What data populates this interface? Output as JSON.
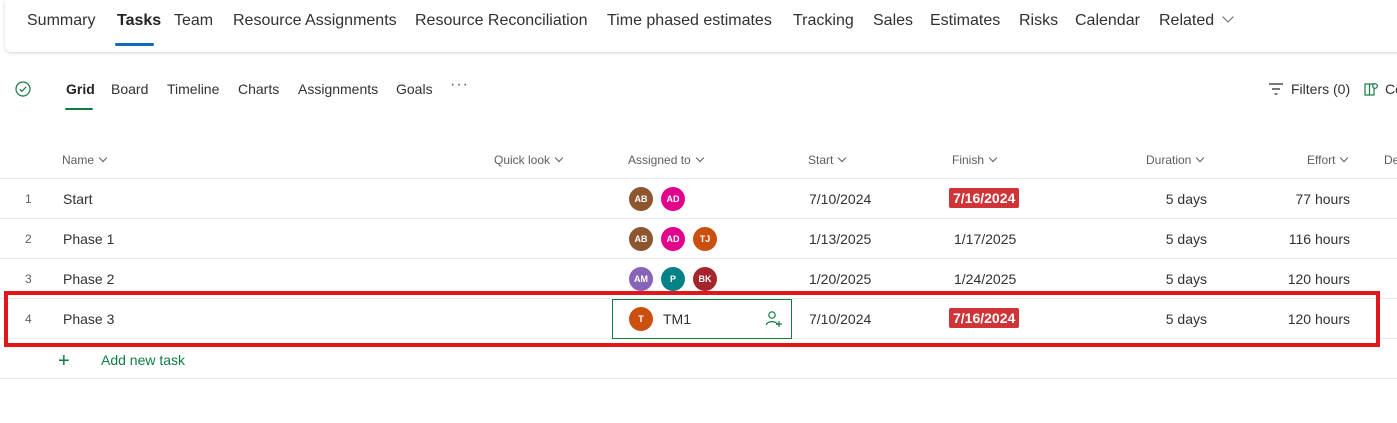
{
  "top_tabs": [
    "Summary",
    "Tasks",
    "Team",
    "Resource Assignments",
    "Resource Reconciliation",
    "Time phased estimates",
    "Tracking",
    "Sales",
    "Estimates",
    "Risks",
    "Calendar",
    "Related"
  ],
  "sub_tabs": [
    "Grid",
    "Board",
    "Timeline",
    "Charts",
    "Assignments",
    "Goals"
  ],
  "more_label": "···",
  "filters_label": "Filters (0)",
  "column_btn_label": "Co",
  "columns": {
    "name": "Name",
    "quick_look": "Quick look",
    "assigned_to": "Assigned to",
    "start": "Start",
    "finish": "Finish",
    "duration": "Duration",
    "effort": "Effort",
    "next": "De"
  },
  "rows": [
    {
      "num": "1",
      "name": "Start",
      "assignees": [
        {
          "initials": "AB",
          "color": "#8e562e"
        },
        {
          "initials": "AD",
          "color": "#e3008c"
        }
      ],
      "start": "7/10/2024",
      "finish": "7/16/2024",
      "finish_late": true,
      "duration": "5 days",
      "effort": "77 hours"
    },
    {
      "num": "2",
      "name": "Phase 1",
      "assignees": [
        {
          "initials": "AB",
          "color": "#8e562e"
        },
        {
          "initials": "AD",
          "color": "#e3008c"
        },
        {
          "initials": "TJ",
          "color": "#ca5010"
        }
      ],
      "start": "1/13/2025",
      "finish": "1/17/2025",
      "finish_late": false,
      "duration": "5 days",
      "effort": "116 hours"
    },
    {
      "num": "3",
      "name": "Phase 2",
      "assignees": [
        {
          "initials": "AM",
          "color": "#8764b8"
        },
        {
          "initials": "P",
          "color": "#038387"
        },
        {
          "initials": "BK",
          "color": "#a4262c"
        }
      ],
      "start": "1/20/2025",
      "finish": "1/24/2025",
      "finish_late": false,
      "duration": "5 days",
      "effort": "120 hours"
    },
    {
      "num": "4",
      "name": "Phase 3",
      "assignees": [
        {
          "initials": "T",
          "color": "#ca5010"
        }
      ],
      "assignee_name": "TM1",
      "start": "7/10/2024",
      "finish": "7/16/2024",
      "finish_late": true,
      "duration": "5 days",
      "effort": "120 hours"
    }
  ],
  "add_task_label": "Add new task",
  "colors": {
    "accent_green": "#107c41",
    "late_red": "#d13438",
    "highlight_red": "#e3161b",
    "top_tab_underline": "#0f6cbd"
  }
}
